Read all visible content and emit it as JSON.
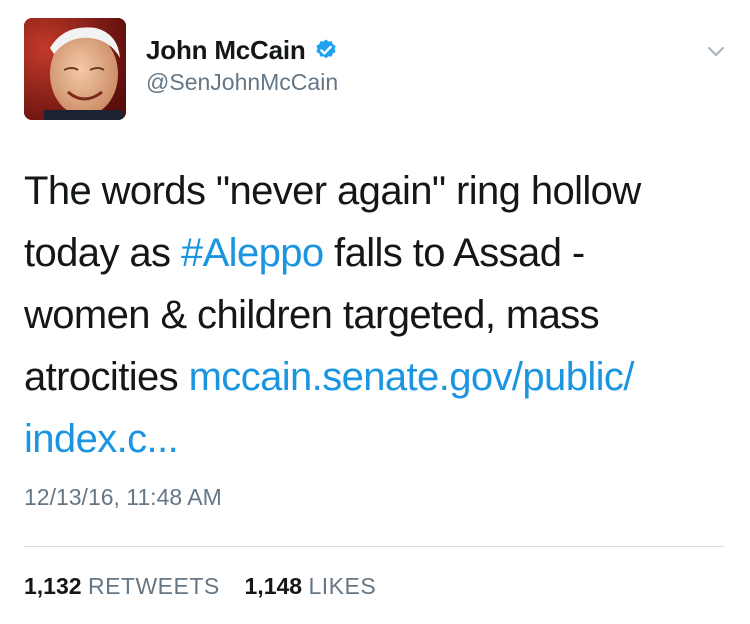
{
  "author": {
    "display_name": "John McCain",
    "handle": "@SenJohnMcCain",
    "verified": true,
    "avatar_icon": "profile-photo"
  },
  "tweet": {
    "text_1": "The words \"never again\" ring hollow today as ",
    "hashtag": "#Aleppo",
    "text_2": " falls to Assad - women & children targeted, mass atrocities ",
    "link": "mccain.senate.gov/public/ index.c...",
    "timestamp": "12/13/16, 11:48 AM"
  },
  "stats": {
    "retweets_count": "1,132",
    "retweets_label": "RETWEETS",
    "likes_count": "1,148",
    "likes_label": "LIKES"
  },
  "colors": {
    "link": "#1b95e0",
    "verified": "#1da1f2",
    "muted": "#657786",
    "text": "#14171a"
  },
  "icons": {
    "verified": "verified-badge-icon",
    "menu": "chevron-down-icon"
  }
}
